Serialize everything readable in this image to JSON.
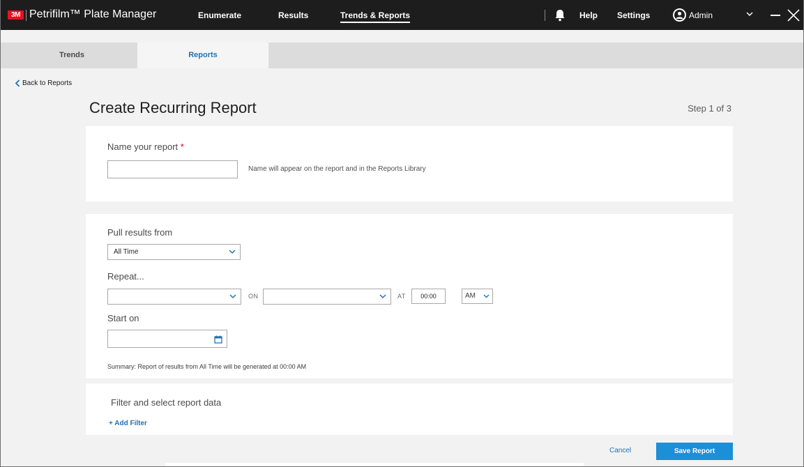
{
  "colors": {
    "accent": "#1d8fd6",
    "link": "#2272b5",
    "topbar": "#1d1d1d",
    "brand": "#e8121f",
    "required": "#d0021b"
  },
  "topbar": {
    "logo": "3M",
    "title": "Petrifilm™ Plate Manager",
    "nav": {
      "enumerate": "Enumerate",
      "results": "Results",
      "trends_reports": "Trends & Reports"
    },
    "help": "Help",
    "settings": "Settings",
    "user": "Admin",
    "icons": [
      "bell-icon",
      "user-icon",
      "chevron-down-icon",
      "minimize-icon",
      "close-icon"
    ]
  },
  "subtabs": {
    "trends": "Trends",
    "reports": "Reports",
    "active": "Reports"
  },
  "back_link": "Back to Reports",
  "page": {
    "title": "Create Recurring Report",
    "step": "Step 1 of 3"
  },
  "name_section": {
    "label": "Name your report",
    "required_mark": "*",
    "value": "",
    "hint": "Name will appear on the report and in the Reports Library"
  },
  "schedule_section": {
    "pull_label": "Pull results from",
    "pull_value": "All Time",
    "repeat_label": "Repeat...",
    "repeat_value": "",
    "on_label": "ON",
    "on_value": "",
    "at_label": "AT",
    "time_value": "00:00",
    "ampm_value": "AM",
    "start_label": "Start on",
    "start_value": "",
    "summary": "Summary: Report of results from All Time will be generated  at 00:00 AM"
  },
  "filter_section": {
    "label": "Filter and select report data",
    "add_filter": "+ Add Filter"
  },
  "actions": {
    "cancel": "Cancel",
    "save": "Save Report"
  }
}
